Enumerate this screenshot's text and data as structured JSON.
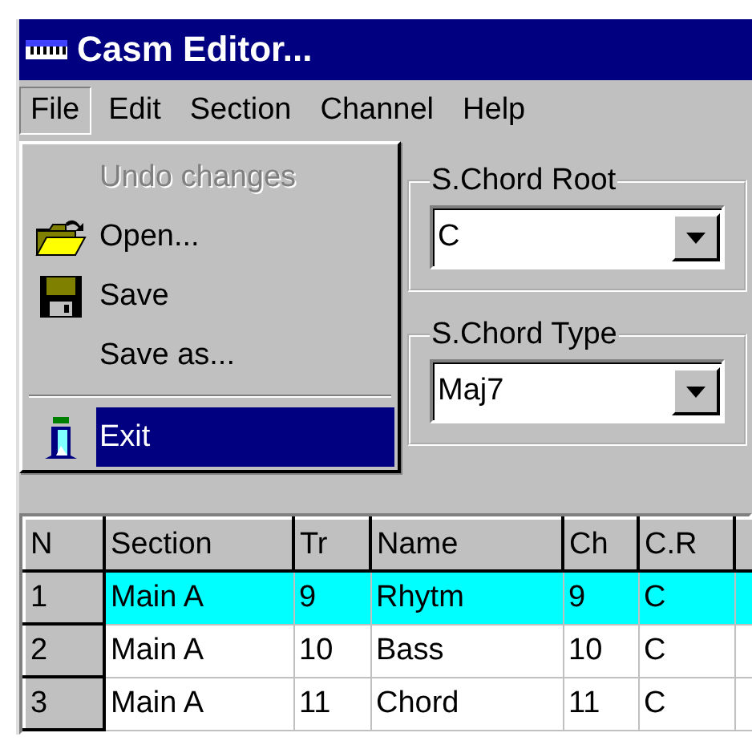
{
  "window": {
    "title": "Casm Editor..."
  },
  "menu_bar": [
    {
      "label": "File",
      "selected": true
    },
    {
      "label": "Edit",
      "selected": false
    },
    {
      "label": "Section",
      "selected": false
    },
    {
      "label": "Channel",
      "selected": false
    },
    {
      "label": "Help",
      "selected": false
    }
  ],
  "file_menu": {
    "items": [
      {
        "kind": "item",
        "label": "Undo changes",
        "disabled": true,
        "selected": false
      },
      {
        "kind": "item",
        "label": "Open...",
        "disabled": false,
        "selected": false
      },
      {
        "kind": "item",
        "label": "Save",
        "disabled": false,
        "selected": false
      },
      {
        "kind": "item",
        "label": "Save as...",
        "disabled": false,
        "selected": false
      },
      {
        "kind": "separator"
      },
      {
        "kind": "item",
        "label": "Exit",
        "disabled": false,
        "selected": true
      }
    ]
  },
  "chord_root": {
    "label": "S.Chord Root",
    "value": "C"
  },
  "chord_type": {
    "label": "S.Chord Type",
    "value": "Maj7"
  },
  "table": {
    "columns": [
      "N",
      "Section",
      "Tr",
      "Name",
      "Ch",
      "C.R"
    ],
    "rows": [
      {
        "cells": [
          "1",
          "Main A",
          "9",
          "Rhytm",
          "9",
          "C"
        ],
        "selected": true
      },
      {
        "cells": [
          "2",
          "Main A",
          "10",
          "Bass",
          "10",
          "C"
        ],
        "selected": false
      },
      {
        "cells": [
          "3",
          "Main A",
          "11",
          "Chord",
          "11",
          "C"
        ],
        "selected": false
      }
    ]
  }
}
